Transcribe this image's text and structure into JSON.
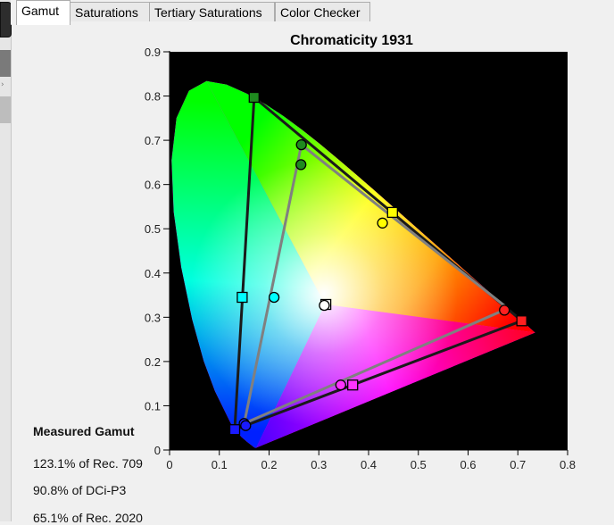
{
  "tabs": [
    {
      "label": "Gamut",
      "active": true
    },
    {
      "label": "Saturations",
      "active": false
    },
    {
      "label": "Tertiary Saturations",
      "active": false
    },
    {
      "label": "Color Checker",
      "active": false
    }
  ],
  "gamut_info": {
    "title": "Measured Gamut",
    "lines": [
      "123.1% of Rec. 709",
      "90.8% of DCi-P3",
      "65.1% of Rec. 2020"
    ]
  },
  "chart_data": {
    "type": "scatter",
    "title": "Chromaticity 1931",
    "xlim": [
      0,
      0.8
    ],
    "ylim": [
      0,
      0.9
    ],
    "xticks": [
      "0",
      "0.1",
      "0.2",
      "0.3",
      "0.4",
      "0.5",
      "0.6",
      "0.7",
      "0.8"
    ],
    "yticks": [
      "0",
      "0.1",
      "0.2",
      "0.3",
      "0.4",
      "0.5",
      "0.6",
      "0.7",
      "0.8",
      "0.9"
    ],
    "background": "#000000",
    "triangles": [
      {
        "marker": "square",
        "stroke": "#1a1a1a",
        "points": [
          [
            0.17,
            0.797
          ],
          [
            0.708,
            0.292
          ],
          [
            0.131,
            0.046
          ]
        ]
      },
      {
        "marker": "circle",
        "stroke": "#808080",
        "points": [
          [
            0.265,
            0.69
          ],
          [
            0.68,
            0.32
          ],
          [
            0.15,
            0.06
          ]
        ]
      }
    ],
    "markers": [
      {
        "shape": "square",
        "x": 0.17,
        "y": 0.797,
        "color": "#1f8a1f"
      },
      {
        "shape": "square",
        "x": 0.708,
        "y": 0.292,
        "color": "#ff2020"
      },
      {
        "shape": "square",
        "x": 0.131,
        "y": 0.046,
        "color": "#1a1aff"
      },
      {
        "shape": "square",
        "x": 0.448,
        "y": 0.537,
        "color": "#ffff00"
      },
      {
        "shape": "square",
        "x": 0.146,
        "y": 0.345,
        "color": "#00ffff"
      },
      {
        "shape": "square",
        "x": 0.368,
        "y": 0.147,
        "color": "#ff33ff"
      },
      {
        "shape": "square",
        "x": 0.314,
        "y": 0.329,
        "color": "#ffffff"
      },
      {
        "shape": "circle",
        "x": 0.265,
        "y": 0.69,
        "color": "#1f8a1f"
      },
      {
        "shape": "circle",
        "x": 0.264,
        "y": 0.645,
        "color": "#1f8a1f"
      },
      {
        "shape": "circle",
        "x": 0.673,
        "y": 0.316,
        "color": "#ff2020"
      },
      {
        "shape": "circle",
        "x": 0.15,
        "y": 0.06,
        "color": "#1a1aff"
      },
      {
        "shape": "circle",
        "x": 0.153,
        "y": 0.055,
        "color": "#1a1aff"
      },
      {
        "shape": "circle",
        "x": 0.428,
        "y": 0.513,
        "color": "#ffff00"
      },
      {
        "shape": "circle",
        "x": 0.21,
        "y": 0.345,
        "color": "#00ffff"
      },
      {
        "shape": "circle",
        "x": 0.344,
        "y": 0.147,
        "color": "#ff33ff"
      },
      {
        "shape": "circle",
        "x": 0.311,
        "y": 0.327,
        "color": "#ffffff"
      }
    ],
    "locus": [
      [
        0.1741,
        0.005
      ],
      [
        0.1738,
        0.0049
      ],
      [
        0.1733,
        0.0048
      ],
      [
        0.1726,
        0.0048
      ],
      [
        0.1714,
        0.0051
      ],
      [
        0.1689,
        0.0069
      ],
      [
        0.1644,
        0.0109
      ],
      [
        0.1566,
        0.0177
      ],
      [
        0.144,
        0.0297
      ],
      [
        0.1241,
        0.0578
      ],
      [
        0.0913,
        0.1327
      ],
      [
        0.0687,
        0.2007
      ],
      [
        0.0454,
        0.295
      ],
      [
        0.0235,
        0.4127
      ],
      [
        0.0082,
        0.5384
      ],
      [
        0.0039,
        0.6548
      ],
      [
        0.0139,
        0.7502
      ],
      [
        0.0389,
        0.812
      ],
      [
        0.0743,
        0.8338
      ],
      [
        0.1142,
        0.8262
      ],
      [
        0.1547,
        0.8059
      ],
      [
        0.1929,
        0.7816
      ],
      [
        0.2296,
        0.7543
      ],
      [
        0.2658,
        0.7243
      ],
      [
        0.3016,
        0.6923
      ],
      [
        0.3373,
        0.6589
      ],
      [
        0.3731,
        0.6245
      ],
      [
        0.4087,
        0.5896
      ],
      [
        0.4441,
        0.5547
      ],
      [
        0.4788,
        0.5202
      ],
      [
        0.5125,
        0.4866
      ],
      [
        0.5448,
        0.4544
      ],
      [
        0.5752,
        0.4242
      ],
      [
        0.6029,
        0.3965
      ],
      [
        0.627,
        0.3725
      ],
      [
        0.6482,
        0.3514
      ],
      [
        0.6658,
        0.334
      ],
      [
        0.6801,
        0.3197
      ],
      [
        0.6915,
        0.3083
      ],
      [
        0.7006,
        0.2993
      ],
      [
        0.7079,
        0.292
      ],
      [
        0.714,
        0.2859
      ],
      [
        0.719,
        0.2809
      ],
      [
        0.723,
        0.277
      ],
      [
        0.726,
        0.274
      ],
      [
        0.7283,
        0.2717
      ],
      [
        0.73,
        0.27
      ],
      [
        0.732,
        0.268
      ],
      [
        0.7347,
        0.2653
      ]
    ]
  }
}
